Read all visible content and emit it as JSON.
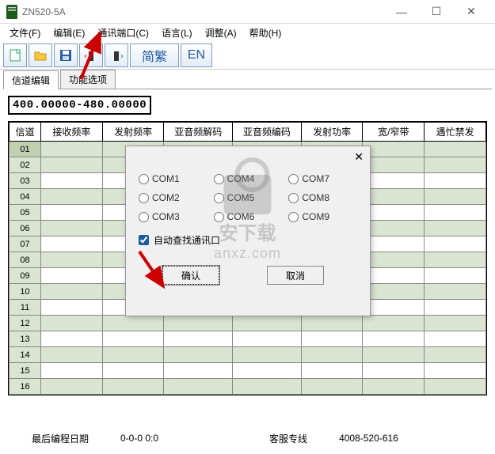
{
  "window": {
    "title": "ZN520-5A"
  },
  "menu": {
    "file": "文件(F)",
    "edit": "编辑(E)",
    "comm_port": "通讯端口(C)",
    "language": "语言(L)",
    "adjust": "调整(A)",
    "help": "帮助(H)"
  },
  "toolbar": {
    "simplified_traditional": "简繁",
    "en": "EN"
  },
  "tabs": {
    "channel_edit": "信道编辑",
    "function_options": "功能选项"
  },
  "freq_range": "400.00000-480.00000",
  "columns": {
    "channel": "信道",
    "rx_freq": "接收频率",
    "tx_freq": "发射频率",
    "ctcss_decode": "亚音频解码",
    "ctcss_encode": "亚音频编码",
    "tx_power": "发射功率",
    "bandwidth": "宽/窄带",
    "busy_lock": "遇忙禁发"
  },
  "rows": [
    "01",
    "02",
    "03",
    "04",
    "05",
    "06",
    "07",
    "08",
    "09",
    "10",
    "11",
    "12",
    "13",
    "14",
    "15",
    "16"
  ],
  "dialog": {
    "com1": "COM1",
    "com2": "COM2",
    "com3": "COM3",
    "com4": "COM4",
    "com5": "COM5",
    "com6": "COM6",
    "com7": "COM7",
    "com8": "COM8",
    "com9": "COM9",
    "auto_find": "自动查找通讯口",
    "ok": "确认",
    "cancel": "取消"
  },
  "status": {
    "last_prog_label": "最后编程日期",
    "last_prog_value": "0-0-0   0:0",
    "hotline_label": "客服专线",
    "hotline_value": "4008-520-616"
  },
  "watermark": {
    "brand": "安下载",
    "domain": "anxz.com"
  }
}
